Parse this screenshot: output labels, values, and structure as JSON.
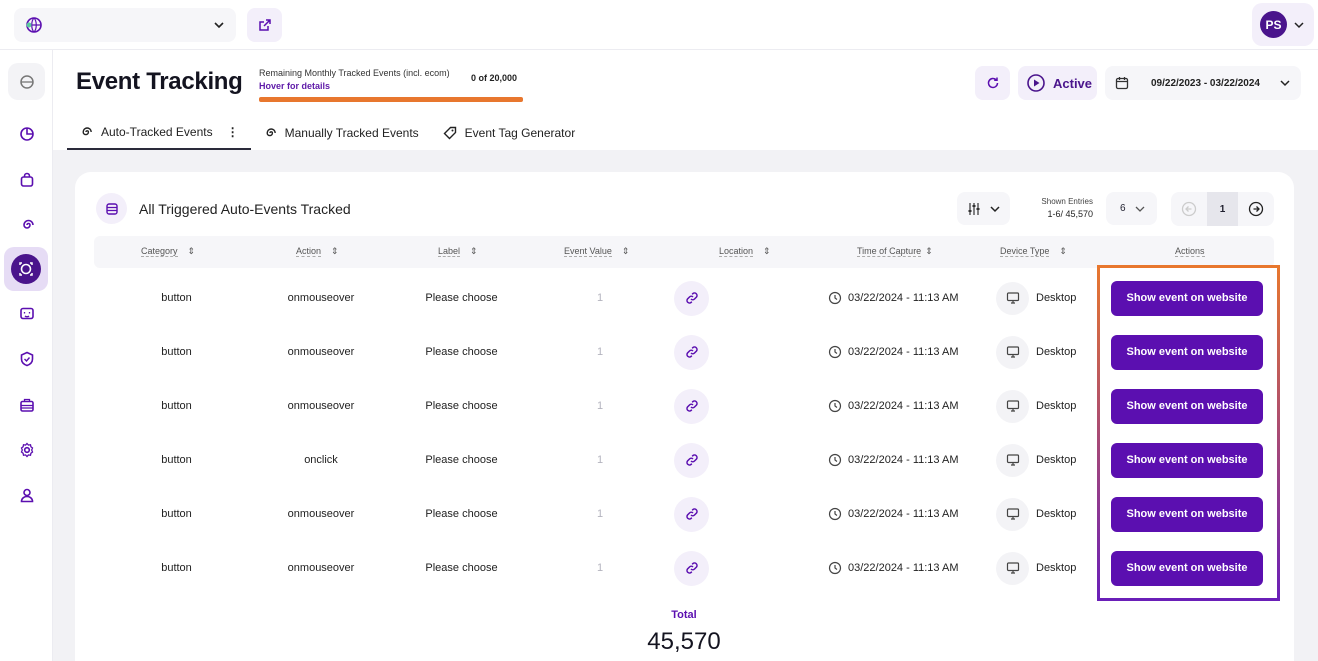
{
  "header": {
    "site_selector_value": "",
    "avatar_initials": "PS"
  },
  "page": {
    "title": "Event Tracking",
    "quota_label": "Remaining Monthly Tracked Events (incl. ecom)",
    "quota_hover": "Hover for details",
    "quota_count": "0 of 20,000",
    "quota_used_fraction": 1.0,
    "status_label": "Active",
    "date_range": "09/22/2023 - 03/22/2024"
  },
  "tabs": [
    {
      "label": "Auto-Tracked Events",
      "selected": true
    },
    {
      "label": "Manually Tracked Events",
      "selected": false
    },
    {
      "label": "Event Tag Generator",
      "selected": false
    }
  ],
  "table": {
    "title": "All Triggered Auto-Events Tracked",
    "shown_entries_label": "Shown Entries",
    "shown_entries_range": "1-6/ 45,570",
    "entries_per_page": "6",
    "current_page": "1",
    "columns": [
      "Category",
      "Action",
      "Label",
      "Event Value",
      "Location",
      "Time of Capture",
      "Device Type",
      "Actions"
    ],
    "rows": [
      {
        "category": "button",
        "action": "onmouseover",
        "label": "Please choose",
        "value": "1",
        "time": "03/22/2024 - 11:13 AM",
        "device": "Desktop",
        "button": "Show event on website"
      },
      {
        "category": "button",
        "action": "onmouseover",
        "label": "Please choose",
        "value": "1",
        "time": "03/22/2024 - 11:13 AM",
        "device": "Desktop",
        "button": "Show event on website"
      },
      {
        "category": "button",
        "action": "onmouseover",
        "label": "Please choose",
        "value": "1",
        "time": "03/22/2024 - 11:13 AM",
        "device": "Desktop",
        "button": "Show event on website"
      },
      {
        "category": "button",
        "action": "onclick",
        "label": "Please choose",
        "value": "1",
        "time": "03/22/2024 - 11:13 AM",
        "device": "Desktop",
        "button": "Show event on website"
      },
      {
        "category": "button",
        "action": "onmouseover",
        "label": "Please choose",
        "value": "1",
        "time": "03/22/2024 - 11:13 AM",
        "device": "Desktop",
        "button": "Show event on website"
      },
      {
        "category": "button",
        "action": "onmouseover",
        "label": "Please choose",
        "value": "1",
        "time": "03/22/2024 - 11:13 AM",
        "device": "Desktop",
        "button": "Show event on website"
      }
    ],
    "total_label": "Total",
    "total_value": "45,570"
  },
  "colors": {
    "brand": "#4a148c",
    "button": "#5b0fb0",
    "quota_bar": "#e8772e"
  },
  "icons": {
    "sidebar": [
      "dashboard-icon",
      "pie-chart-icon",
      "shopping-bag-icon",
      "spiral-icon",
      "event-tracking-icon",
      "feedback-icon",
      "shield-icon",
      "briefcase-icon",
      "settings-icon",
      "user-icon"
    ]
  }
}
